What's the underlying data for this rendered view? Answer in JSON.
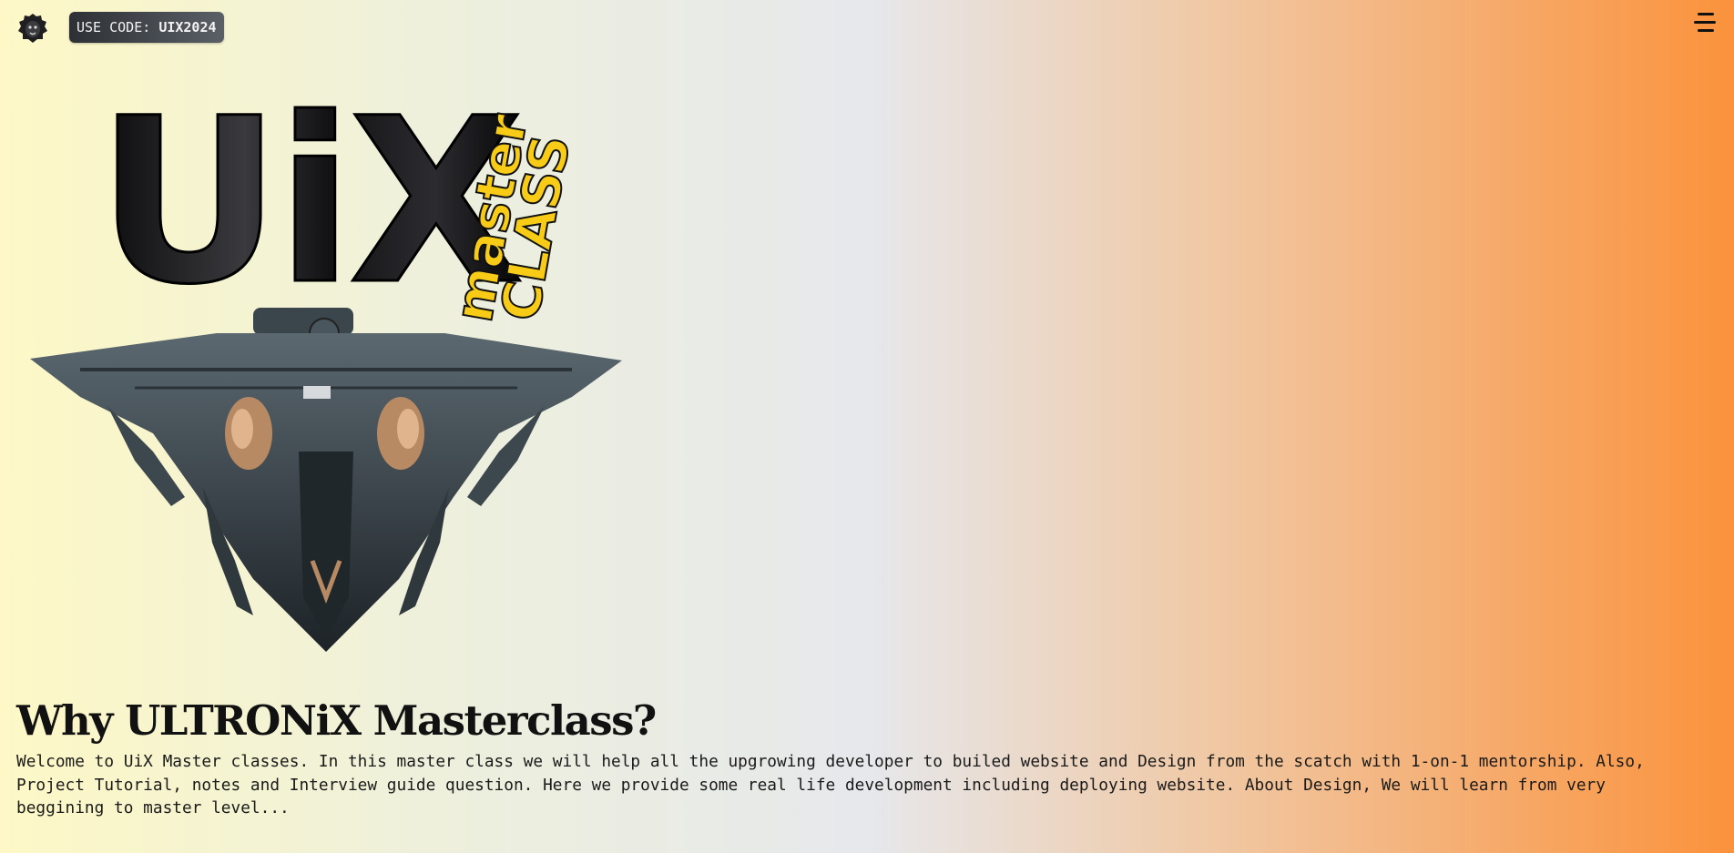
{
  "header": {
    "logo_icon": "lion-head-icon",
    "promo_prefix": "USE CODE: ",
    "promo_code": "UIX2024",
    "menu_icon": "hamburger-menu-icon"
  },
  "hero": {
    "balloon_text": "UiX",
    "badge_top": "master",
    "badge_bottom": "CLASS",
    "image_icon": "spaceship-illustration"
  },
  "content": {
    "heading": "Why ULTRONiX Masterclass?",
    "description": "Welcome to UiX Master classes. In this master class we will help all the upgrowing developer to builed website and Design from the scatch with 1-on-1 mentorship. Also, Project Tutorial, notes and Interview guide question. Here we provide some real life development including deploying website. About Design, We will learn from very beggining to master level..."
  },
  "colors": {
    "gradient_start": "#fdf8c6",
    "gradient_mid": "#e6e8ec",
    "gradient_end": "#fb923c",
    "badge_yellow": "#f7cb16",
    "balloon_black": "#1c1c1e"
  }
}
